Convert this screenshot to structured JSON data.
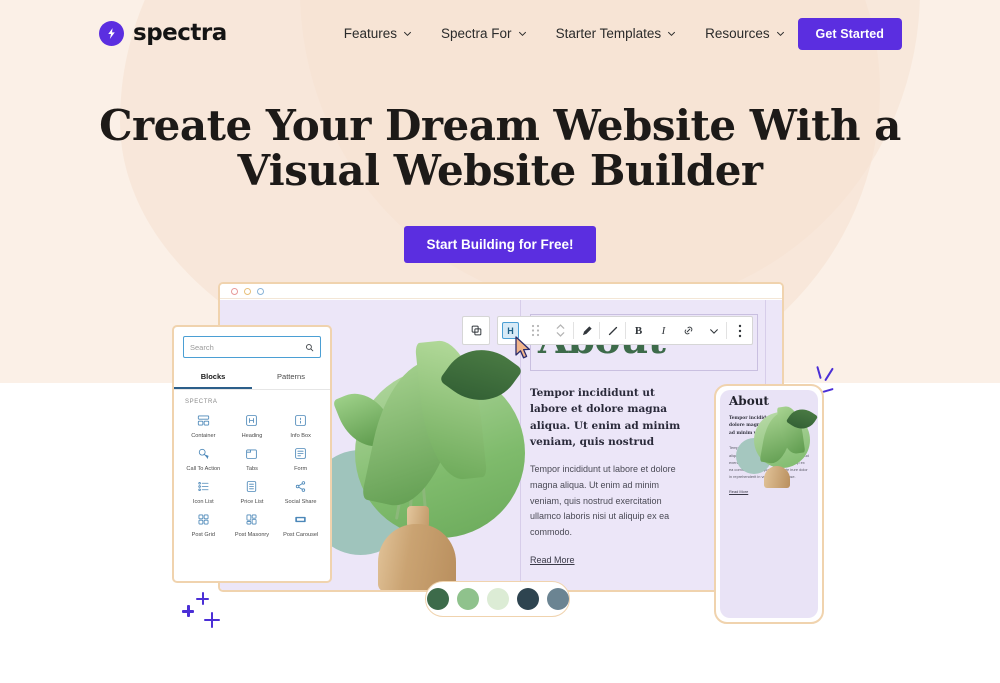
{
  "brand": {
    "name": "spectra",
    "logo_icon": "lightning-bolt-icon",
    "accent": "#5b2ee0"
  },
  "header": {
    "nav": [
      {
        "label": "Features",
        "icon": "chevron-down-icon"
      },
      {
        "label": "Spectra For",
        "icon": "chevron-down-icon"
      },
      {
        "label": "Starter Templates",
        "icon": "chevron-down-icon"
      },
      {
        "label": "Resources",
        "icon": "chevron-down-icon"
      }
    ],
    "cta_label": "Get Started"
  },
  "hero": {
    "heading_line1": "Create Your Dream Website With a",
    "heading_line2": "Visual Website Builder",
    "cta_label": "Start Building for Free!"
  },
  "editor": {
    "window_dots": [
      "red",
      "yellow",
      "blue"
    ],
    "inserter": {
      "search_placeholder": "Search",
      "search_icon": "search-icon",
      "tabs": [
        {
          "label": "Blocks",
          "active": true
        },
        {
          "label": "Patterns",
          "active": false
        }
      ],
      "section_label": "SPECTRA",
      "blocks": [
        {
          "label": "Container",
          "icon": "container-icon"
        },
        {
          "label": "Heading",
          "icon": "heading-icon"
        },
        {
          "label": "Info Box",
          "icon": "info-box-icon"
        },
        {
          "label": "Call To Action",
          "icon": "call-to-action-icon"
        },
        {
          "label": "Tabs",
          "icon": "tabs-icon"
        },
        {
          "label": "Form",
          "icon": "form-icon"
        },
        {
          "label": "Icon List",
          "icon": "icon-list-icon"
        },
        {
          "label": "Price List",
          "icon": "price-list-icon"
        },
        {
          "label": "Social Share",
          "icon": "social-share-icon"
        },
        {
          "label": "Post Grid",
          "icon": "post-grid-icon"
        },
        {
          "label": "Post Masonry",
          "icon": "post-masonry-icon"
        },
        {
          "label": "Post Carousel",
          "icon": "post-carousel-icon"
        }
      ]
    },
    "toolbar": {
      "copy_icon": "copy-block-icon",
      "buttons": [
        {
          "name": "block-type-heading",
          "label": "H",
          "icon": "heading-block-icon",
          "active": true
        },
        {
          "name": "drag-handle",
          "label": "",
          "icon": "drag-handle-icon",
          "active": false
        },
        {
          "name": "move-updown",
          "label": "",
          "icon": "move-up-down-icon",
          "active": false
        },
        {
          "name": "transform",
          "label": "",
          "icon": "pen-icon",
          "active": false
        },
        {
          "name": "style-brush",
          "label": "",
          "icon": "brush-icon",
          "active": false
        },
        {
          "name": "bold",
          "label": "B",
          "icon": "bold-icon",
          "active": false
        },
        {
          "name": "italic",
          "label": "I",
          "icon": "italic-icon",
          "active": false
        },
        {
          "name": "link",
          "label": "",
          "icon": "link-icon",
          "active": false
        },
        {
          "name": "more-formats",
          "label": "",
          "icon": "chevron-down-icon",
          "active": false
        },
        {
          "name": "block-options",
          "label": "",
          "icon": "three-dots-icon",
          "active": false
        }
      ]
    },
    "canvas": {
      "about_heading": "About",
      "about_heading_color": "#3d6b4a",
      "subhead": "Tempor incididunt ut labore et dolore magna aliqua. Ut enim ad minim veniam, quis nostrud",
      "body": "Tempor incididunt ut labore et dolore magna aliqua. Ut enim ad minim veniam, quis nostrud exercitation ullamco laboris nisi ut aliquip ex ea commodo.",
      "read_more": "Read More"
    },
    "phone": {
      "about_heading": "About",
      "subhead": "Tempor incididunt ut labore et dolore magna aliqua. Ut enim ad minim veniam, quis nostrud",
      "body": "Tempor incididunt ut labore et dolore magna aliqua. Ut enim ad minim veniam, quis nostrud exercitation ullamco laboris nisi ut aliquip ex ea commodo consequat. Duis aute irure dolor in reprehenderit in voluptate velit esse.",
      "read_more": "Read More"
    },
    "palette": {
      "swatches": [
        "#3d6b4a",
        "#8fc28c",
        "#dcecd5",
        "#2e4450",
        "#6b8492"
      ]
    }
  },
  "decor": {
    "sparkle_plus_icon": "plus-sparkle-icon",
    "sparkle_burst_icon": "sparkle-burst-icon"
  }
}
